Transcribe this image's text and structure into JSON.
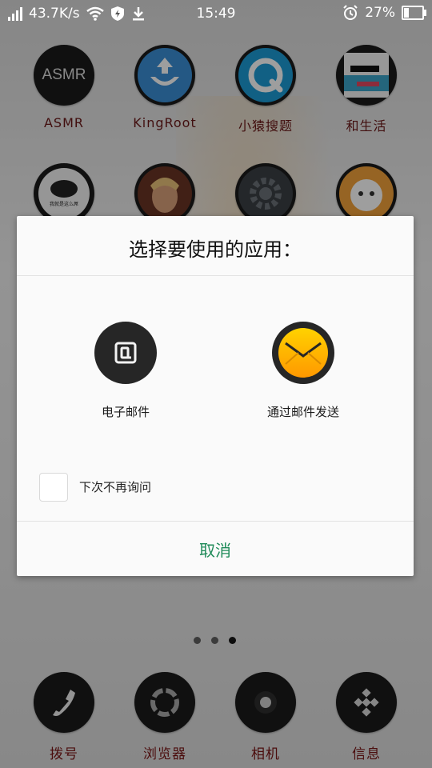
{
  "status_bar": {
    "network_speed": "43.7K/s",
    "time": "15:49",
    "battery_percent": "27%",
    "battery_level": 0.27
  },
  "home": {
    "row1": [
      {
        "label": "ASMR",
        "icon_text": "ASMR"
      },
      {
        "label": "KingRoot"
      },
      {
        "label": "小猿搜题"
      },
      {
        "label": "和生活"
      }
    ],
    "row2_icon_text": "我就是这么屌"
  },
  "dialog": {
    "title": "选择要使用的应用：",
    "options": [
      {
        "label": "电子邮件",
        "icon": "at-sign-icon"
      },
      {
        "label": "通过邮件发送",
        "icon": "envelope-icon"
      }
    ],
    "remember_label": "下次不再询问",
    "cancel_label": "取消"
  },
  "dock": [
    {
      "label": "拨号",
      "icon": "phone-icon"
    },
    {
      "label": "浏览器",
      "icon": "browser-icon"
    },
    {
      "label": "相机",
      "icon": "camera-icon"
    },
    {
      "label": "信息",
      "icon": "message-icon"
    }
  ],
  "page_indicator": {
    "count": 3,
    "active_index": 2
  }
}
